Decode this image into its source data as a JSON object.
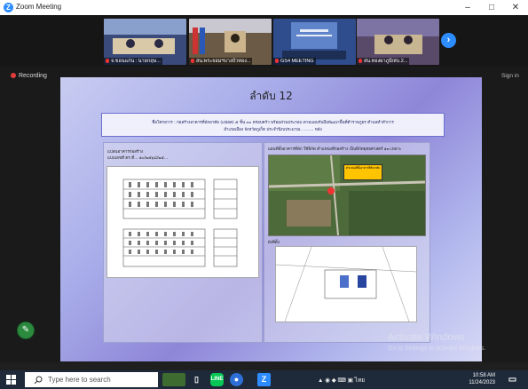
{
  "window": {
    "title": "Zoom Meeting",
    "minimize": "–",
    "maximize": "□",
    "close": "✕"
  },
  "participants": [
    {
      "name": "จ.ขอนแก่น : นายกฤษ...",
      "bg": "#3a4a7a"
    },
    {
      "name": "สน.พระจอมฯบางบัวทอง...",
      "bg": "#6b5a45"
    },
    {
      "name": "GS4 MEETING",
      "bg": "#2f4d8c"
    },
    {
      "name": "สน.ทองผาภูมิ/สบ.2...",
      "bg": "#5a4a6a"
    }
  ],
  "status": {
    "recording": "Recording",
    "sign_in": "Sign in"
  },
  "slide": {
    "title": "ลำดับ 12",
    "project_line1": "ชื่อโครงการ : ก่อสร้างอาคารที่พักอาศัย (แฟลต) ๕ ชั้น ๓๐ ครอบครัว พร้อมส่วนประกอบ ตามแผนรับมือพัฒนาพื้นที่ตำรวจภูธร ตำบลทำทำการ",
    "project_line2": "อำเภอเมือง จังหวัดภูเก็ต ประจำปีงบประมาณ ……… หลัง",
    "left_caption1": "แปลนอาคารก่อสร้าง",
    "left_caption2": "แบบเลขที่ ตร.ที่…  ๑๐/๒๕๖๘/๒๕…",
    "right_caption": "แผนที่ตั้งอาคารที่พัก ใช้พิกัด ตำแหน่งที่ก่อสร้าง เป็นพิกัดยุทธศาสตร์ ๑๓ เหลาะ",
    "map_tag": "ตำแหน่งที่ตั้งอาคารที่พักอาศัย",
    "plan_caption": "ผังที่ตั้ง"
  },
  "windows_watermark": {
    "line1": "Activate Windows",
    "line2": "Go to Settings to activate Windows."
  },
  "taskbar": {
    "search_placeholder": "Type here to search",
    "tray_text": "ไทย",
    "clock_time": "10:58 AM",
    "clock_date": "11/24/2023"
  },
  "colors": {
    "zoom_blue": "#2d8cff",
    "recording_red": "#e23b3b",
    "taskbar": "#1e2a3a"
  }
}
